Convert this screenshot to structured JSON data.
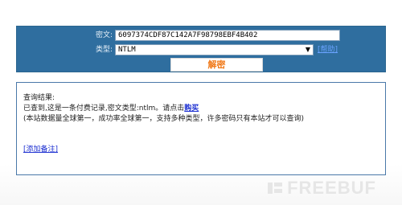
{
  "form": {
    "cipher_label": "密文:",
    "cipher_value": "6097374CDF87C142A7F98798EBF4B402",
    "type_label": "类型:",
    "type_value": "NTLM",
    "help_link": "[帮助]",
    "decrypt_button": "解密"
  },
  "result": {
    "title": "查询结果:",
    "line1_prefix": "已查到,这是一条付费记录,密文类型:ntlm。请点击",
    "buy_link": "购买",
    "line2": "(本站数据量全球第一，成功率全球第一，支持多种类型，许多密码只有本站才可以查询)",
    "add_note_link": "[添加备注]"
  },
  "watermark": {
    "text": "FREEBUF"
  },
  "colors": {
    "form_panel": "#2f6e9f",
    "decrypt_text": "#f07a1a",
    "link_blue": "#1c2fd1",
    "help_link": "#6aa3ff",
    "result_border": "#4a78a9"
  }
}
